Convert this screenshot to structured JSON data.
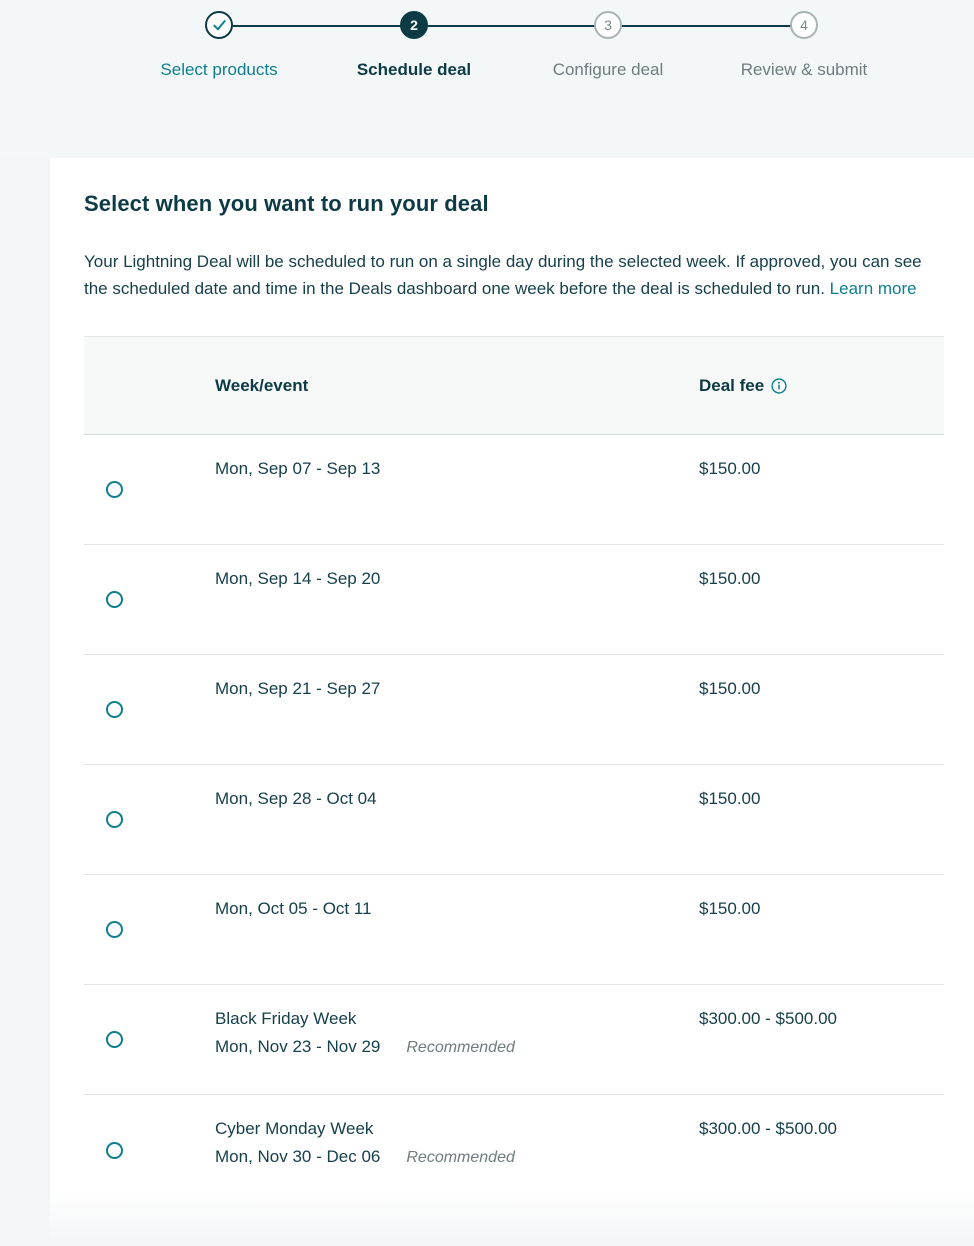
{
  "stepper": {
    "steps": [
      {
        "marker": "check-icon",
        "label": "Select products",
        "state": "done"
      },
      {
        "marker": "2",
        "label": "Schedule deal",
        "state": "current"
      },
      {
        "marker": "3",
        "label": "Configure deal",
        "state": "upcoming"
      },
      {
        "marker": "4",
        "label": "Review & submit",
        "state": "upcoming"
      }
    ]
  },
  "page": {
    "title": "Select when you want to run your deal",
    "intro_text": "Your Lightning Deal will be scheduled to run on a single day during the selected week. If approved, you can see the scheduled date and time in the Deals dashboard one week before the deal is scheduled to run. ",
    "learn_more": "Learn more"
  },
  "table": {
    "headers": {
      "week": "Week/event",
      "fee": "Deal fee",
      "fee_info_icon": "info-icon"
    },
    "rows": [
      {
        "event": "",
        "dates": "Mon, Sep 07 - Sep 13",
        "tag": "",
        "fee": "$150.00",
        "selected": false
      },
      {
        "event": "",
        "dates": "Mon, Sep 14 - Sep 20",
        "tag": "",
        "fee": "$150.00",
        "selected": false
      },
      {
        "event": "",
        "dates": "Mon, Sep 21 - Sep 27",
        "tag": "",
        "fee": "$150.00",
        "selected": false
      },
      {
        "event": "",
        "dates": "Mon, Sep 28 - Oct 04",
        "tag": "",
        "fee": "$150.00",
        "selected": false
      },
      {
        "event": "",
        "dates": "Mon, Oct 05 - Oct 11",
        "tag": "",
        "fee": "$150.00",
        "selected": false
      },
      {
        "event": "Black Friday Week",
        "dates": "Mon, Nov 23 - Nov 29",
        "tag": "Recommended",
        "fee": "$300.00 - $500.00",
        "selected": false
      },
      {
        "event": "Cyber Monday Week",
        "dates": "Mon, Nov 30 - Dec 06",
        "tag": "Recommended",
        "fee": "$300.00 - $500.00",
        "selected": false
      }
    ]
  },
  "colors": {
    "accent_teal": "#0d7f8e",
    "dark_navy": "#0d3b45",
    "page_background": "#f2f6f7",
    "header_row_background": "#f7f8f8",
    "muted_text": "#6f7c80"
  }
}
